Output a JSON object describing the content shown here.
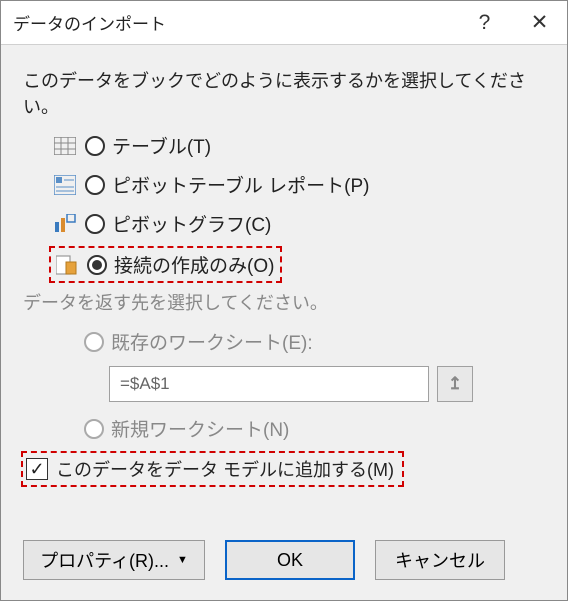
{
  "title": "データのインポート",
  "prompt": "このデータをブックでどのように表示するかを選択してください。",
  "options": {
    "table": "テーブル(T)",
    "pivot_table": "ピボットテーブル レポート(P)",
    "pivot_chart": "ピボットグラフ(C)",
    "connection_only": "接続の作成のみ(O)"
  },
  "location_prompt": "データを返す先を選択してください。",
  "location": {
    "existing": "既存のワークシート(E):",
    "cell_value": "=$A$1",
    "new_sheet": "新規ワークシート(N)"
  },
  "add_model": "このデータをデータ モデルに追加する(M)",
  "buttons": {
    "properties": "プロパティ(R)...",
    "ok": "OK",
    "cancel": "キャンセル"
  },
  "icons": {
    "help": "?",
    "close": "✕",
    "range": "↥",
    "check": "✓",
    "caret": "▼"
  }
}
